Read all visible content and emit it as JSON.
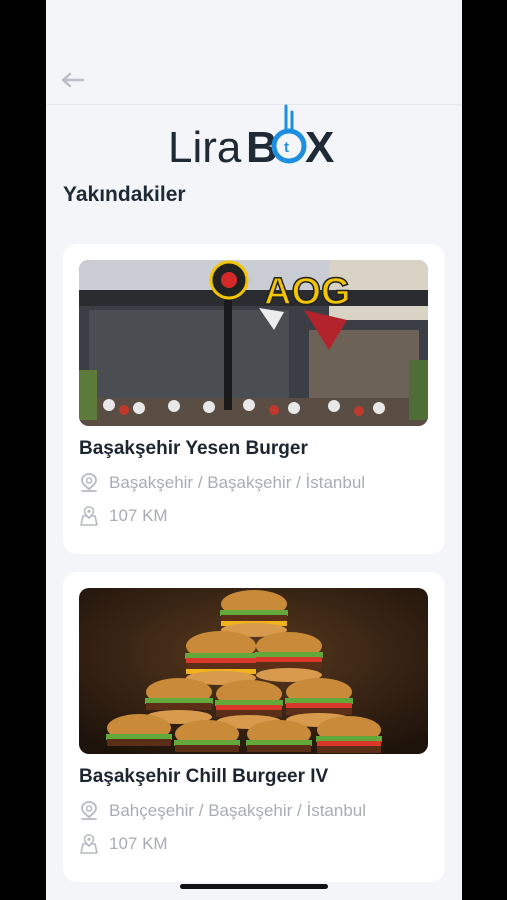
{
  "app": {
    "brand_prefix": "Lira",
    "brand_suffix_b": "B",
    "brand_suffix_x": "X",
    "brand_coin": "t"
  },
  "header": {
    "back_icon": "back-arrow-icon"
  },
  "section": {
    "title": "Yakındakiler"
  },
  "restaurants": [
    {
      "name": "Başakşehir Yesen Burger",
      "location": "Başakşehir / Başakşehir / İstanbul",
      "distance": "107 KM",
      "sign_text": "AOG"
    },
    {
      "name": "Başakşehir Chill Burgeer IV",
      "location": "Bahçeşehir / Başakşehir / İstanbul",
      "distance": "107 KM"
    }
  ],
  "colors": {
    "brand_dark": "#1f2a36",
    "brand_blue": "#1e8fe0",
    "muted": "#a8adb5"
  }
}
